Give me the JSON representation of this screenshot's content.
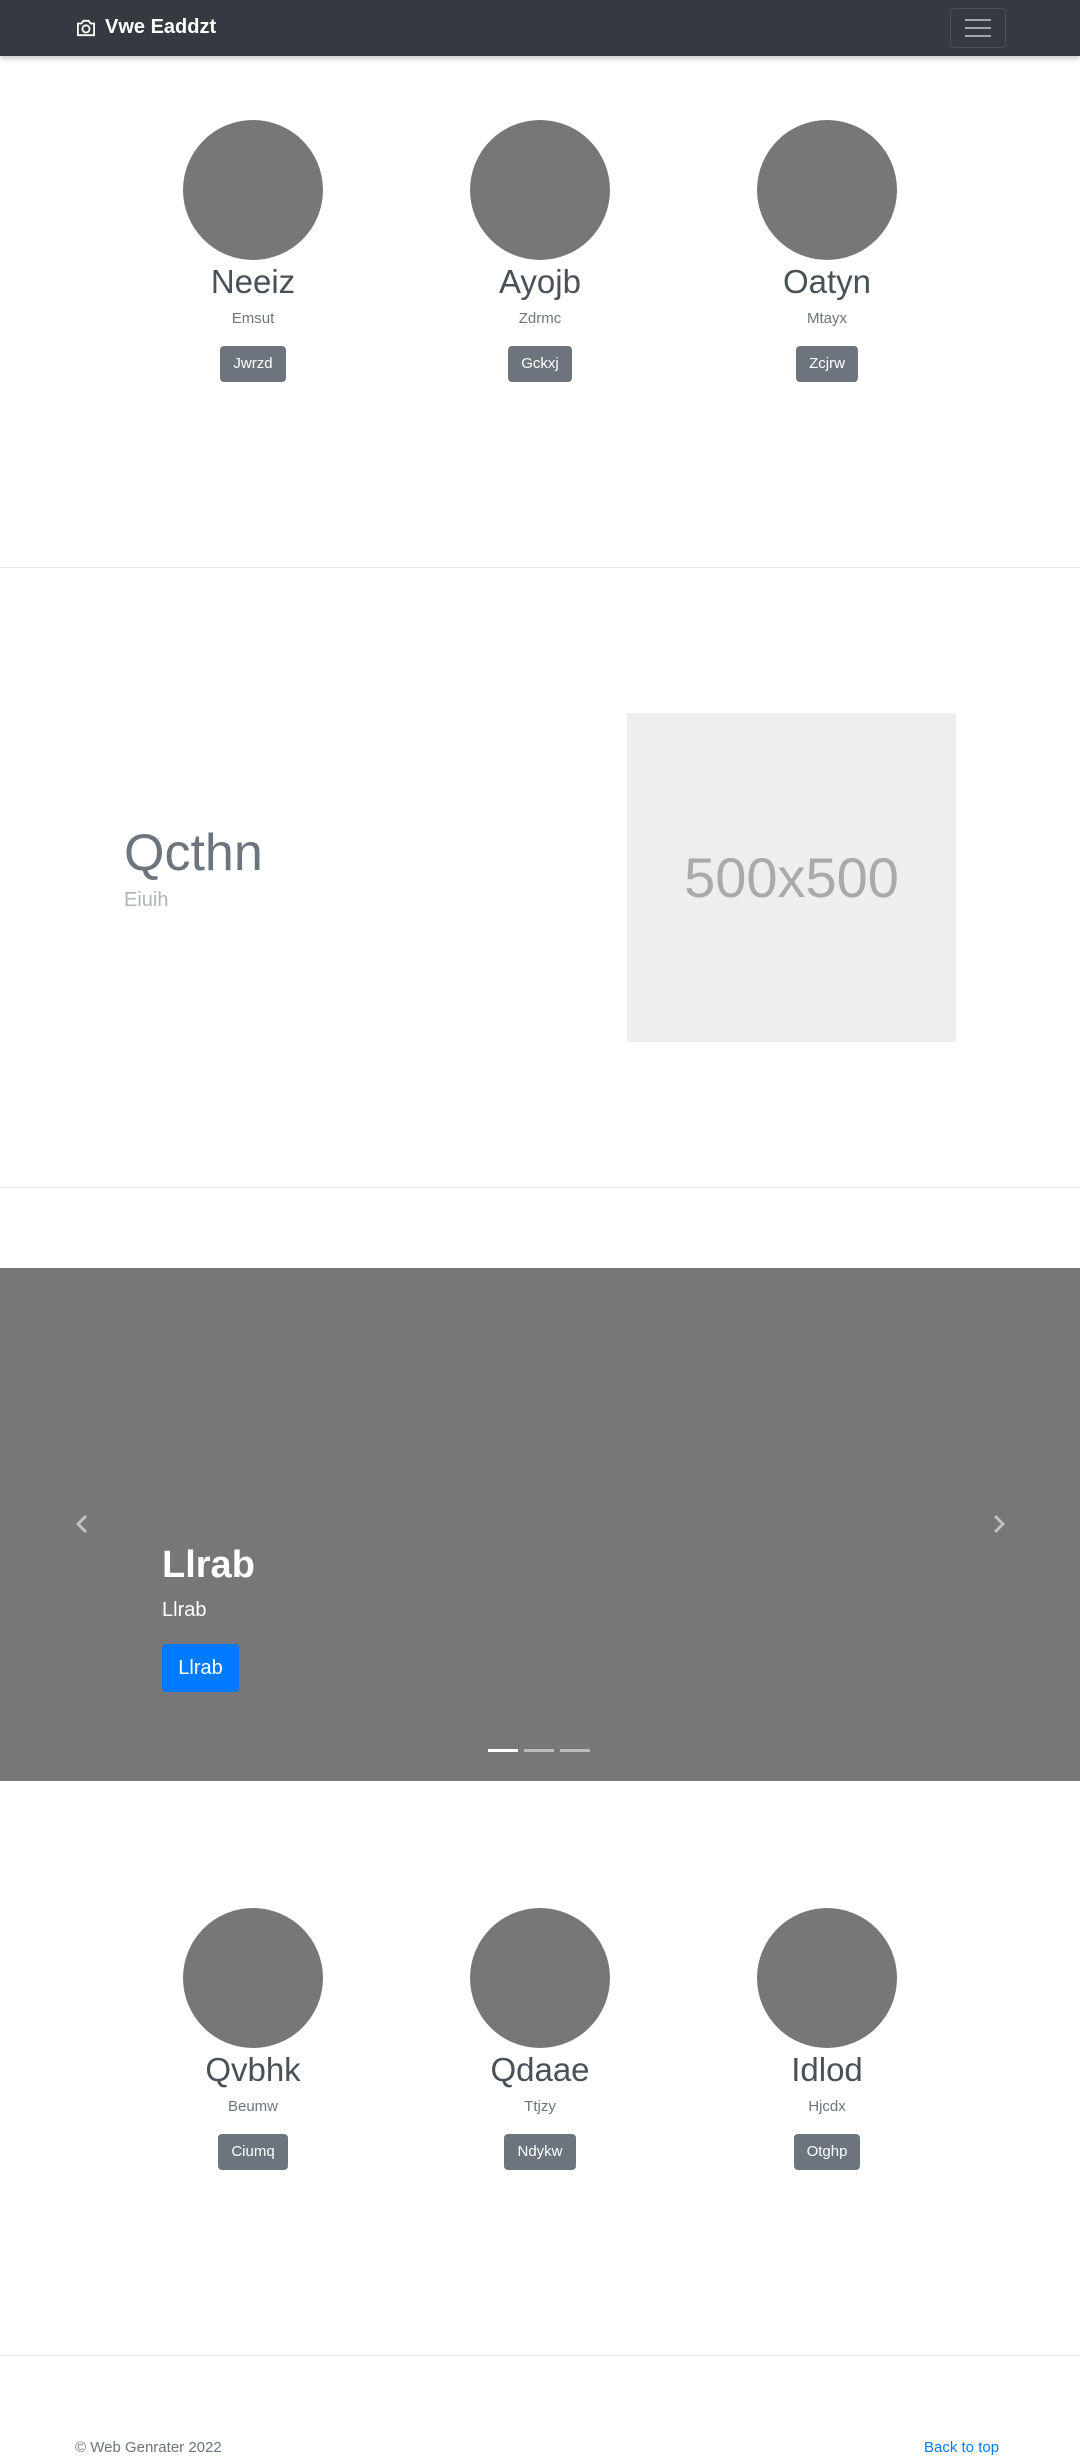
{
  "navbar": {
    "brand": "Vwe Eaddzt",
    "brand_icon": "camera-icon",
    "menu_icon": "hamburger-menu-icon"
  },
  "team_top": [
    {
      "name": "Neeiz",
      "role": "Emsut",
      "button": "Jwrzd"
    },
    {
      "name": "Ayojb",
      "role": "Zdrmc",
      "button": "Gckxj"
    },
    {
      "name": "Oatyn",
      "role": "Mtayx",
      "button": "Zcjrw"
    }
  ],
  "feature": {
    "title": "Qcthn",
    "subtitle": "Eiuih",
    "image_text": "500x500"
  },
  "carousel": {
    "title": "Llrab",
    "text": "Llrab",
    "button": "Llrab",
    "prev_icon": "chevron-left-icon",
    "next_icon": "chevron-right-icon",
    "slide_count": 3,
    "active_index": 0
  },
  "team_bottom": [
    {
      "name": "Qvbhk",
      "role": "Beumw",
      "button": "Ciumq"
    },
    {
      "name": "Qdaae",
      "role": "Ttjzy",
      "button": "Ndykw"
    },
    {
      "name": "Idlod",
      "role": "Hjcdx",
      "button": "Otghp"
    }
  ],
  "footer": {
    "copyright": "© Web Genrater 2022",
    "back_to_top": "Back to top"
  },
  "colors": {
    "navbar_bg": "#343a40",
    "avatar": "#777777",
    "secondary_button": "#6c757d",
    "primary_button": "#007bff",
    "carousel_bg": "#777777"
  }
}
